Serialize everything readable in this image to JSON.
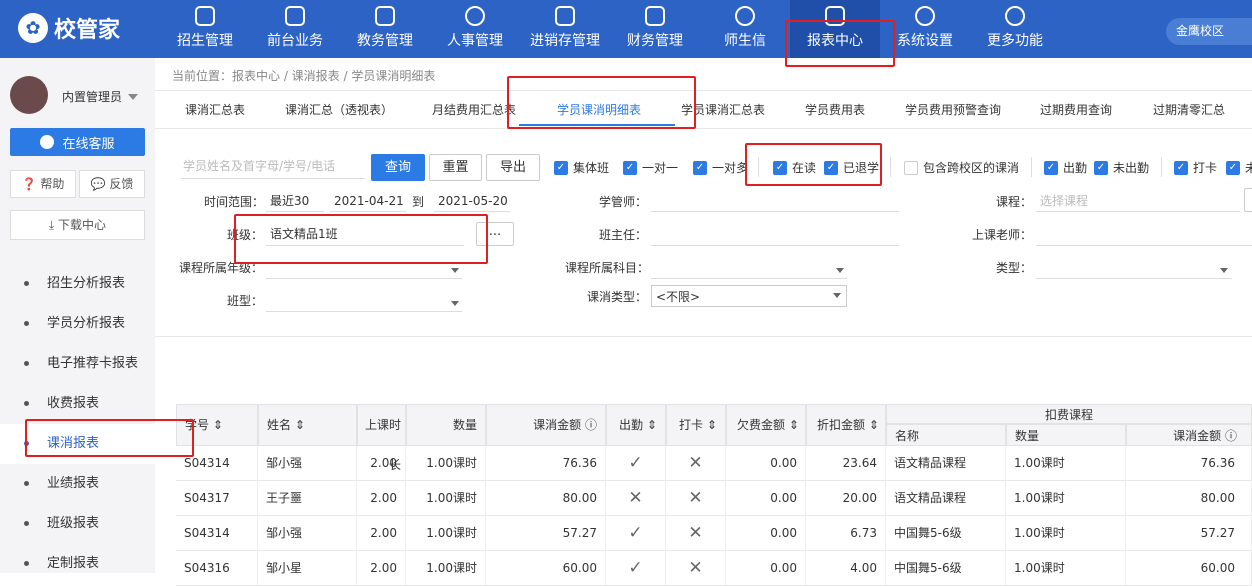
{
  "app": {
    "logo_text": "校管家",
    "campus": "金鹰校区"
  },
  "nav": [
    {
      "label": "招生管理",
      "icon": "user-plus-icon"
    },
    {
      "label": "前台业务",
      "icon": "screen-icon"
    },
    {
      "label": "教务管理",
      "icon": "book-icon"
    },
    {
      "label": "人事管理",
      "icon": "person-icon"
    },
    {
      "label": "进销存管理",
      "icon": "box-icon"
    },
    {
      "label": "财务管理",
      "icon": "money-icon"
    },
    {
      "label": "师生信",
      "icon": "chat-icon"
    },
    {
      "label": "报表中心",
      "icon": "chart-icon"
    },
    {
      "label": "系统设置",
      "icon": "gear-icon"
    },
    {
      "label": "更多功能",
      "icon": "more-icon"
    }
  ],
  "user": {
    "name": "内置管理员"
  },
  "sidebar": {
    "service": "在线客服",
    "help": "帮助",
    "feedback": "反馈",
    "download": "下载中心",
    "items": [
      {
        "label": "招生分析报表"
      },
      {
        "label": "学员分析报表"
      },
      {
        "label": "电子推荐卡报表"
      },
      {
        "label": "收费报表"
      },
      {
        "label": "课消报表"
      },
      {
        "label": "业绩报表"
      },
      {
        "label": "班级报表"
      },
      {
        "label": "定制报表"
      }
    ]
  },
  "breadcrumb": "当前位置：报表中心 / 课消报表 / 学员课消明细表",
  "tabs": [
    {
      "label": "课消汇总表"
    },
    {
      "label": "课消汇总（透视表）"
    },
    {
      "label": "月结费用汇总表"
    },
    {
      "label": "学员课消明细表"
    },
    {
      "label": "学员课消汇总表"
    },
    {
      "label": "学员费用表"
    },
    {
      "label": "学员费用预警查询"
    },
    {
      "label": "过期费用查询"
    },
    {
      "label": "过期清零汇总"
    }
  ],
  "toolbar": {
    "search_placeholder": "学员姓名及首字母/学号/电话",
    "query": "查询",
    "reset": "重置",
    "export": "导出",
    "checks": [
      {
        "label": "集体班",
        "checked": true
      },
      {
        "label": "一对一",
        "checked": true
      },
      {
        "label": "一对多",
        "checked": true
      },
      {
        "label": "在读",
        "checked": true
      },
      {
        "label": "已退学",
        "checked": true
      },
      {
        "label": "包含跨校区的课消",
        "checked": false
      },
      {
        "label": "出勤",
        "checked": true
      },
      {
        "label": "未出勤",
        "checked": true
      },
      {
        "label": "打卡",
        "checked": true
      },
      {
        "label": "未",
        "checked": true
      }
    ]
  },
  "filters": {
    "time_label": "时间范围：",
    "time_preset": "最近30",
    "date_from": "2021-04-21",
    "to": "到",
    "date_to": "2021-05-20",
    "class_label": "班级：",
    "class_value": "语文精品1班",
    "class_btn": "...",
    "grade_label": "课程所属年级：",
    "classtype_label": "班型：",
    "advisor_label": "学管师：",
    "headteacher_label": "班主任：",
    "subject_label": "课程所属科目：",
    "consume_type_label": "课消类型：",
    "consume_type_value": "<不限>",
    "course_label": "课程：",
    "course_placeholder": "选择课程",
    "teacher_label": "上课老师：",
    "type_label": "类型："
  },
  "table": {
    "headers": {
      "id": "学号",
      "name": "姓名",
      "duration": "上课时长",
      "qty": "数量",
      "amount": "课消金额",
      "attend": "出勤",
      "punch": "打卡",
      "owe": "欠费金额",
      "discount": "折扣金额",
      "deduct": "扣费课程",
      "d_name": "名称",
      "d_qty": "数量",
      "d_amount": "课消金额"
    },
    "rows": [
      {
        "id": "S04314",
        "name": "邹小强",
        "duration": "2.00",
        "qty": "1.00课时",
        "amount": "76.36",
        "attend": "✓",
        "punch": "✕",
        "owe": "0.00",
        "discount": "23.64",
        "d_name": "语文精品课程",
        "d_qty": "1.00课时",
        "d_amount": "76.36"
      },
      {
        "id": "S04317",
        "name": "王子噩",
        "duration": "2.00",
        "qty": "1.00课时",
        "amount": "80.00",
        "attend": "✕",
        "punch": "✕",
        "owe": "0.00",
        "discount": "20.00",
        "d_name": "语文精品课程",
        "d_qty": "1.00课时",
        "d_amount": "80.00"
      },
      {
        "id": "S04314",
        "name": "邹小强",
        "duration": "2.00",
        "qty": "1.00课时",
        "amount": "57.27",
        "attend": "✓",
        "punch": "✕",
        "owe": "0.00",
        "discount": "6.73",
        "d_name": "中国舞5-6级",
        "d_qty": "1.00课时",
        "d_amount": "57.27"
      },
      {
        "id": "S04316",
        "name": "邹小星",
        "duration": "2.00",
        "qty": "1.00课时",
        "amount": "60.00",
        "attend": "✓",
        "punch": "✕",
        "owe": "0.00",
        "discount": "4.00",
        "d_name": "中国舞5-6级",
        "d_qty": "1.00课时",
        "d_amount": "60.00"
      }
    ]
  },
  "colors": {
    "primary": "#2c63c4",
    "accent": "#2c7be5",
    "highlight": "#e02020"
  }
}
